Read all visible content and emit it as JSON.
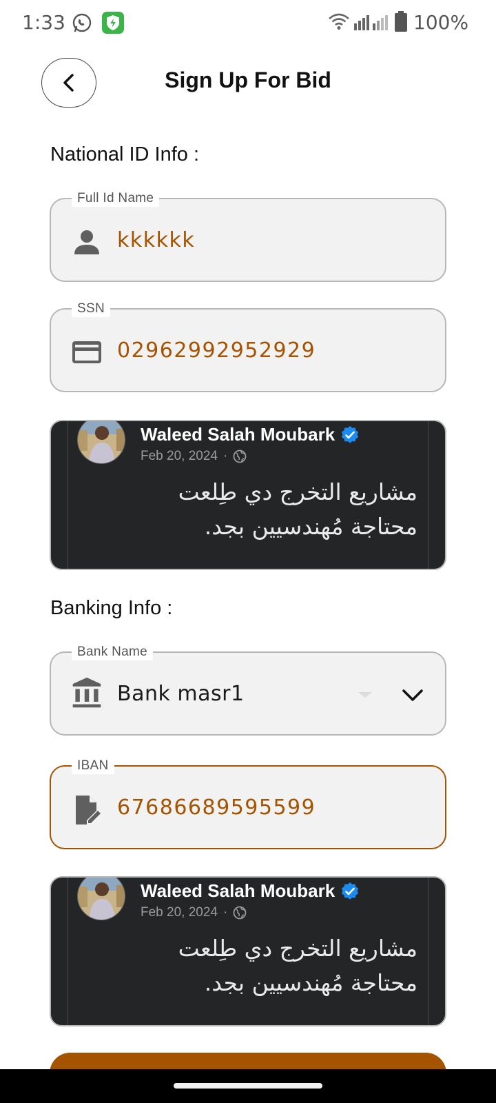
{
  "status_bar": {
    "time": "1:33",
    "battery_percent": "100%",
    "icons": [
      "whatsapp-icon",
      "shield-app-icon",
      "wifi-icon",
      "signal-icon",
      "battery-icon"
    ]
  },
  "header": {
    "title": "Sign Up For Bid",
    "back_icon": "chevron-left-icon"
  },
  "national_id": {
    "section_title": "National ID Info :",
    "full_name": {
      "label": "Full Id Name",
      "value": "kkkkkk",
      "icon": "person-icon"
    },
    "ssn": {
      "label": "SSN",
      "value": "02962992952929",
      "icon": "credit-card-icon"
    },
    "attachment": {
      "name": "Waleed Salah Moubark",
      "date": "Feb 20, 2024",
      "separator": "·",
      "text_line1": "مشاريع التخرج دي طِلعت",
      "text_line2": "محتاجة مُهندسيين بجد."
    }
  },
  "banking": {
    "section_title": "Banking Info :",
    "bank_name": {
      "label": "Bank Name",
      "value": "Bank masr1",
      "icon": "bank-icon"
    },
    "iban": {
      "label": "IBAN",
      "value": "67686689595599",
      "icon": "document-edit-icon"
    },
    "attachment": {
      "name": "Waleed Salah Moubark",
      "date": "Feb 20, 2024",
      "separator": "·",
      "text_line1": "مشاريع التخرج دي طِلعت",
      "text_line2": "محتاجة مُهندسيين بجد."
    }
  },
  "colors": {
    "accent": "#a65300",
    "field_background": "#f2f2f2",
    "field_border": "#b7b7b7",
    "card_background": "#242526"
  }
}
